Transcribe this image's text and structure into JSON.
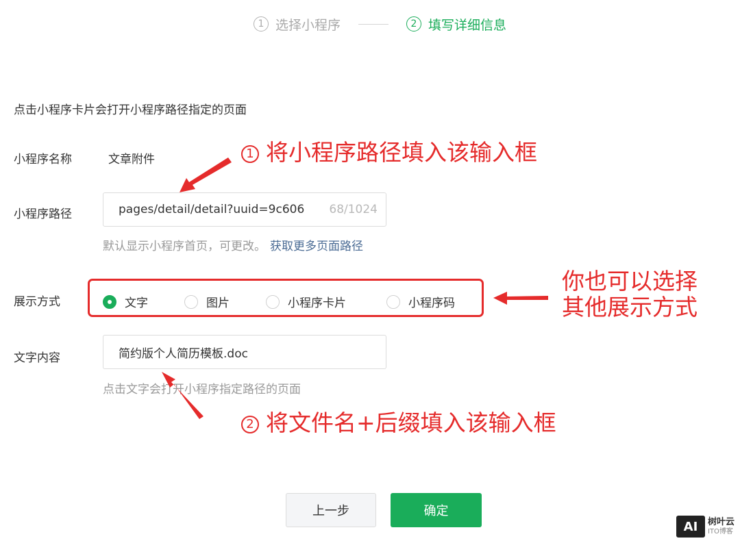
{
  "steps": [
    {
      "num": "1",
      "label": "选择小程序"
    },
    {
      "num": "2",
      "label": "填写详细信息"
    }
  ],
  "form": {
    "description": "点击小程序卡片会打开小程序路径指定的页面",
    "name_label": "小程序名称",
    "name_value": "文章附件",
    "path_label": "小程序路径",
    "path_value": "pages/detail/detail?uuid=9c606",
    "path_count": "68/1024",
    "path_hint": "默认显示小程序首页，可更改。",
    "path_hint_link": "获取更多页面路径",
    "display_label": "展示方式",
    "display_options": [
      {
        "label": "文字",
        "checked": true
      },
      {
        "label": "图片",
        "checked": false
      },
      {
        "label": "小程序卡片",
        "checked": false
      },
      {
        "label": "小程序码",
        "checked": false
      }
    ],
    "text_label": "文字内容",
    "text_value": "简约版个人简历模板.doc",
    "text_hint": "点击文字会打开小程序指定路径的页面"
  },
  "annotations": {
    "a1_num": "1",
    "a1_text": "将小程序路径填入该输入框",
    "a2_line1": "你也可以选择",
    "a2_line2": "其他展示方式",
    "a3_num": "2",
    "a3_text": "将文件名+后缀填入该输入框"
  },
  "buttons": {
    "prev": "上一步",
    "confirm": "确定"
  },
  "watermark": {
    "logo": "AI",
    "line1": "树叶云",
    "line2": "ITO博客"
  },
  "colors": {
    "accent": "#1aad5a",
    "annotation": "#e52b2b",
    "link": "#4a6b94"
  }
}
